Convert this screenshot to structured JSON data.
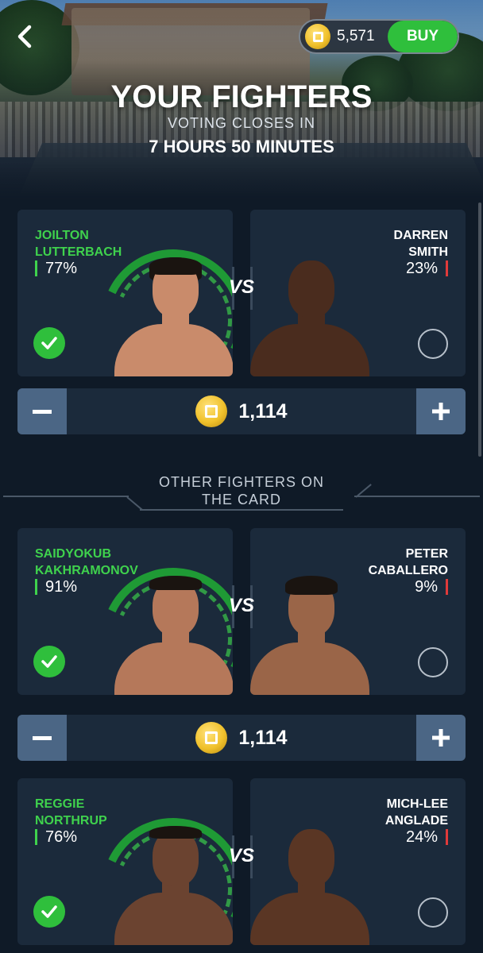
{
  "header": {
    "title": "YOUR FIGHTERS",
    "voting_label": "VOTING CLOSES IN",
    "countdown": "7 HOURS 50 MINUTES",
    "balance": "5,571",
    "buy_label": "BUY"
  },
  "section": {
    "other_label_line1": "OTHER FIGHTERS ON",
    "other_label_line2": "THE CARD"
  },
  "vs_label": "VS",
  "fights": [
    {
      "left": {
        "name_line1": "JOILTON",
        "name_line2": "LUTTERBACH",
        "pct": "77%",
        "selected": true
      },
      "right": {
        "name_line1": "DARREN",
        "name_line2": "SMITH",
        "pct": "23%",
        "selected": false
      },
      "stake": "1,114"
    },
    {
      "left": {
        "name_line1": "SAIDYOKUB",
        "name_line2": "KAKHRAMONOV",
        "pct": "91%",
        "selected": true
      },
      "right": {
        "name_line1": "PETER",
        "name_line2": "CABALLERO",
        "pct": "9%",
        "selected": false
      },
      "stake": "1,114"
    },
    {
      "left": {
        "name_line1": "REGGIE",
        "name_line2": "NORTHRUP",
        "pct": "76%",
        "selected": true
      },
      "right": {
        "name_line1": "MICH-LEE",
        "name_line2": "ANGLADE",
        "pct": "24%",
        "selected": false
      }
    }
  ],
  "icons": {
    "back": "chevron-left-icon",
    "coin": "coin-icon",
    "check": "check-icon",
    "plus": "plus-icon",
    "minus": "minus-icon"
  },
  "colors": {
    "accent_green": "#2fbf3c",
    "win_green": "#3fd24d",
    "loss_red": "#e03a3a",
    "card_bg": "#1b2a3b",
    "page_bg": "#0f1a27",
    "stepper_bg": "#4b6685"
  }
}
